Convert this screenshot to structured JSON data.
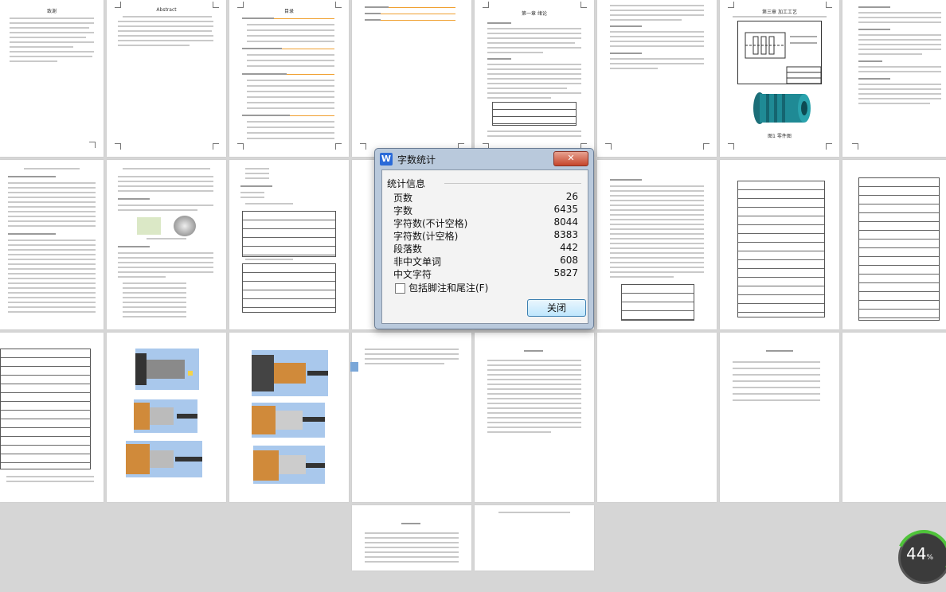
{
  "pages": {
    "r1": [
      "致谢",
      "Abstract",
      "目录",
      "",
      "第一章 绪论",
      "",
      "第三章 加工工艺",
      "",
      ""
    ],
    "figure_caption": "图1 零件图"
  },
  "dialog": {
    "title": "字数统计",
    "close_x": "关闭",
    "group_label": "统计信息",
    "stats": [
      {
        "label": "页数",
        "value": "26"
      },
      {
        "label": "字数",
        "value": "6435"
      },
      {
        "label": "字符数(不计空格)",
        "value": "8044"
      },
      {
        "label": "字符数(计空格)",
        "value": "8383"
      },
      {
        "label": "段落数",
        "value": "442"
      },
      {
        "label": "非中文单词",
        "value": "608"
      },
      {
        "label": "中文字符",
        "value": "5827"
      }
    ],
    "checkbox_label": "包括脚注和尾注(F)",
    "close_button": "关闭"
  },
  "zoom": {
    "value": "44",
    "unit": "%"
  },
  "colors": {
    "background": "#d6d6d6",
    "accent": "#2a6ad8",
    "zoom_ring": "#4fc33a"
  }
}
